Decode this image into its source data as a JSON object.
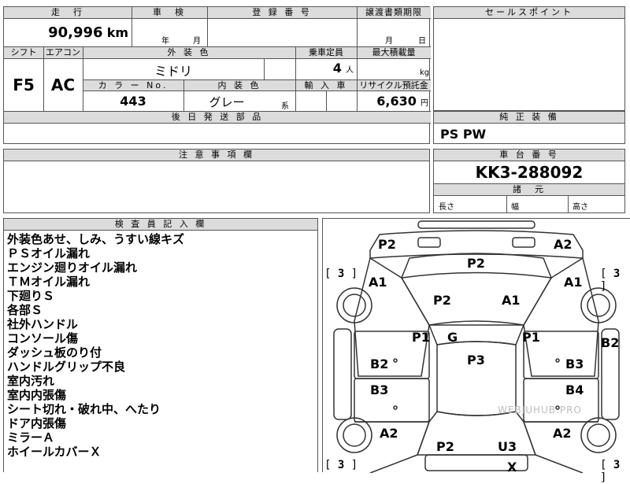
{
  "top_table": {
    "mileage_header": "走　行",
    "mileage_value": "90,996",
    "mileage_unit": "km",
    "inspection_header": "車　検",
    "inspection_year": "年",
    "inspection_month": "月",
    "registration_header": "登 録 番 号",
    "transfer_header": "譲渡書類期限",
    "transfer_month": "月",
    "transfer_day": "日",
    "shift_header": "シフト",
    "shift_value": "F5",
    "aircon_header": "エアコン",
    "aircon_value": "AC",
    "exterior_color_header": "外 装 色",
    "exterior_color_value": "ミドリ",
    "seating_header": "乗車定員",
    "seating_value": "4",
    "seating_unit": "人",
    "max_load_header": "最大積載量",
    "max_load_unit": "kg",
    "color_no_header": "カ ラ ー No.",
    "color_no_value": "443",
    "interior_color_header": "内 装 色",
    "interior_color_value": "グレー",
    "interior_color_suffix": "系",
    "import_header": "輸 入 車",
    "recycle_header": "リサイクル預託金",
    "recycle_value": "6,630",
    "recycle_unit": "円",
    "later_parts_header": "後 日 発 送 部 品"
  },
  "sales_point": {
    "header": "セールスポイント"
  },
  "equipment": {
    "header": "純 正 装 備",
    "value": "PS PW"
  },
  "caution": {
    "header": "注 意 事 項 欄"
  },
  "chassis": {
    "header": "車 台 番 号",
    "value": "KK3-288092",
    "dims_header": "諸　元",
    "length_label": "長さ",
    "width_label": "幅",
    "height_label": "高さ"
  },
  "inspector": {
    "header": "検 査 員 記 入 欄",
    "notes": [
      "外装色あせ、しみ、うすい線キズ",
      "ＰＳオイル漏れ",
      "エンジン廻りオイル漏れ",
      "ＴＭオイル漏れ",
      "下廻りＳ",
      "各部Ｓ",
      "社外ハンドル",
      "コンソール傷",
      "ダッシュ板のり付",
      "ハンドルグリップ不良",
      "室内汚れ",
      "室内内張傷",
      "シート切れ・破れ中、へたり",
      "ドア内張傷",
      "ミラーＡ",
      "ホイールカバーＸ"
    ]
  },
  "diagram": {
    "labels": {
      "front_left_p2": "P2",
      "front_right_a2": "A2",
      "bonnet_p2": "P2",
      "left_fender_a1": "A1",
      "right_fender_a1": "A1",
      "hood_p2": "P2",
      "hood_a1": "A1",
      "left_pillar_p1": "P1",
      "right_pillar_p1": "P1",
      "windshield_g": "G",
      "roof_p3": "P3",
      "left_door_b2": "B2",
      "right_door_b3": "B3",
      "right_edge_b2": "B2",
      "left_rear_door_b3": "B3",
      "right_rear_door_b4": "B4",
      "left_quarter_a2": "A2",
      "right_quarter_a2": "A2",
      "trunk_p2": "P2",
      "trunk_u3": "U3",
      "rear_x": "X"
    },
    "tires": {
      "left_front": "3",
      "right_front": "3",
      "left_rear": "3",
      "right_rear": "3"
    },
    "watermark": "WEBJUHUB.PRO"
  }
}
